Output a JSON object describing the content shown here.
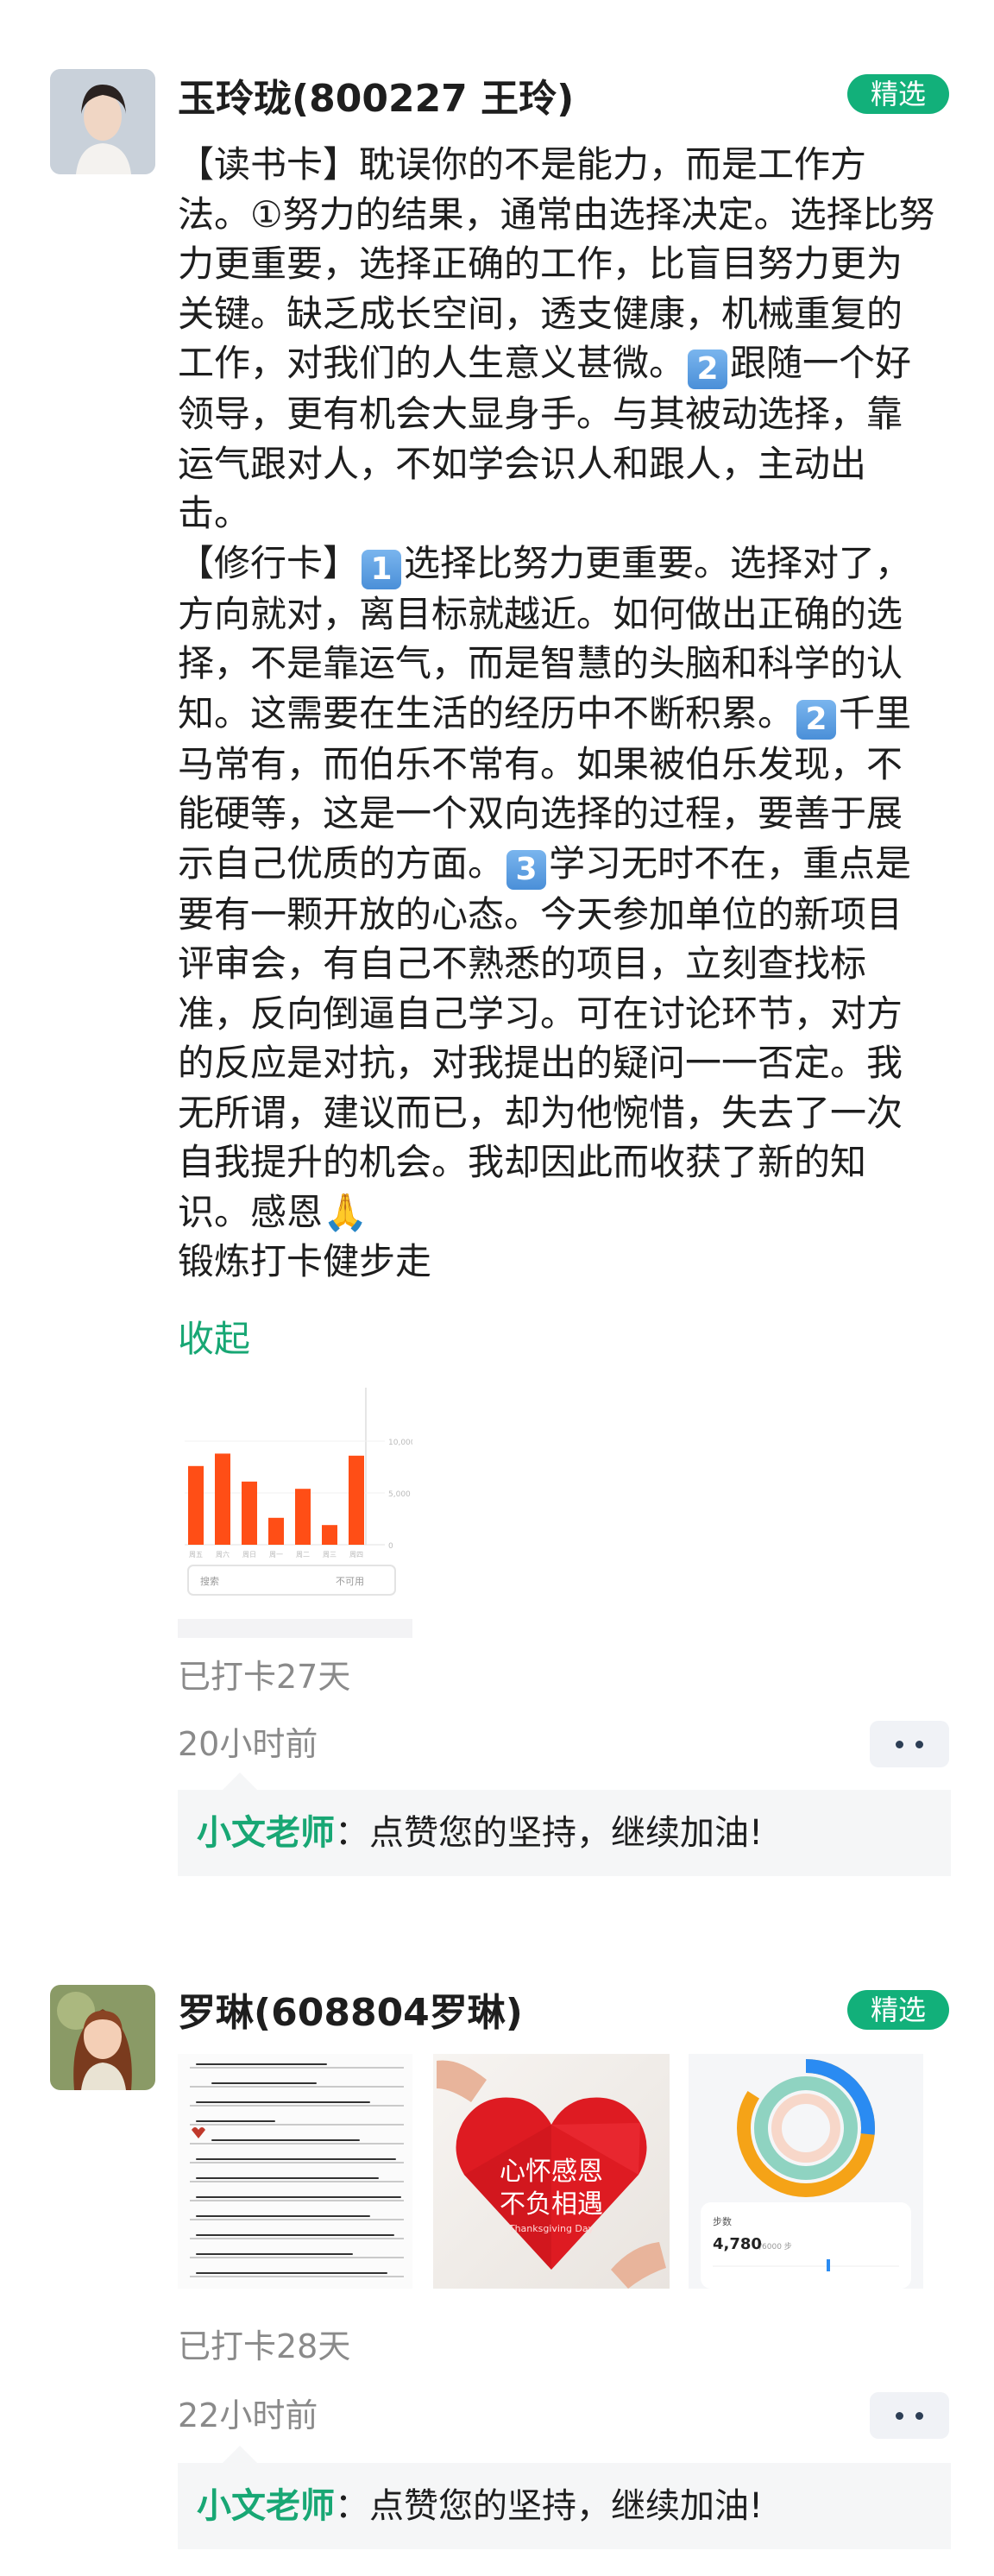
{
  "posts": [
    {
      "name": "玉玲珑(800227 王玲)",
      "badge": "精选",
      "text_parts": {
        "p1": "【读书卡】耽误你的不是能力，而是工作方法。①努力的结果，通常由选择决定。选择比努力更重要，选择正确的工作，比盲目努力更为关键。缺乏成长空间，透支健康，机械重复的工作，对我们的人生意义甚微。",
        "n1": "2",
        "p2": "跟随一个好领导，更有机会大显身手。与其被动选择，靠运气跟对人，不如学会识人和跟人，主动出击。\n【修行卡】",
        "n2": "1",
        "p3": "选择比努力更重要。选择对了，方向就对，离目标就越近。如何做出正确的选择，不是靠运气，而是智慧的头脑和科学的认知。这需要在生活的经历中不断积累。",
        "n3": "2",
        "p4": "千里马常有，而伯乐不常有。如果被伯乐发现，不能硬等，这是一个双向选择的过程，要善于展示自己优质的方面。",
        "n4": "3",
        "p5": "学习无时不在，重点是要有一颗开放的心态。今天参加单位的新项目评审会，有自己不熟悉的项目，立刻查找标准，反向倒逼自己学习。可在讨论环节，对方的反应是对抗，对我提出的疑问一一否定。我无所谓，建议而已，却为他惋惜，失去了一次自我提升的机会。我却因此而收获了新的知识。感恩🙏\n锻炼打卡健步走"
      },
      "collapse_label": "收起",
      "streak": "已打卡27天",
      "time": "20小时前",
      "comment": {
        "author": "小文老师",
        "text": "：点赞您的坚持，继续加油!"
      },
      "step_chart": {
        "values": [
          7600,
          8800,
          6100,
          2600,
          5400,
          1900,
          8600
        ],
        "x_labels": [
          "周五",
          "周六",
          "周日",
          "周一",
          "周二",
          "周三",
          "周四"
        ],
        "y_labels": [
          "10,000",
          "5,000",
          "0"
        ],
        "search_placeholder": "搜索",
        "search_hint": "不可用"
      }
    },
    {
      "name": "罗琳(608804罗琳)",
      "badge": "精选",
      "images": {
        "card_line1": "心怀感恩",
        "card_line2": "不负相遇",
        "card_sub": "Thanksgiving Day",
        "steps_title": "步数",
        "steps_value": "4,780",
        "steps_unit": "/6000 步"
      },
      "streak": "已打卡28天",
      "time": "22小时前",
      "comment": {
        "author": "小文老师",
        "text": "：点赞您的坚持，继续加油!"
      }
    }
  ],
  "colors": {
    "accent": "#12b07a",
    "bar": "#ff4e16"
  }
}
